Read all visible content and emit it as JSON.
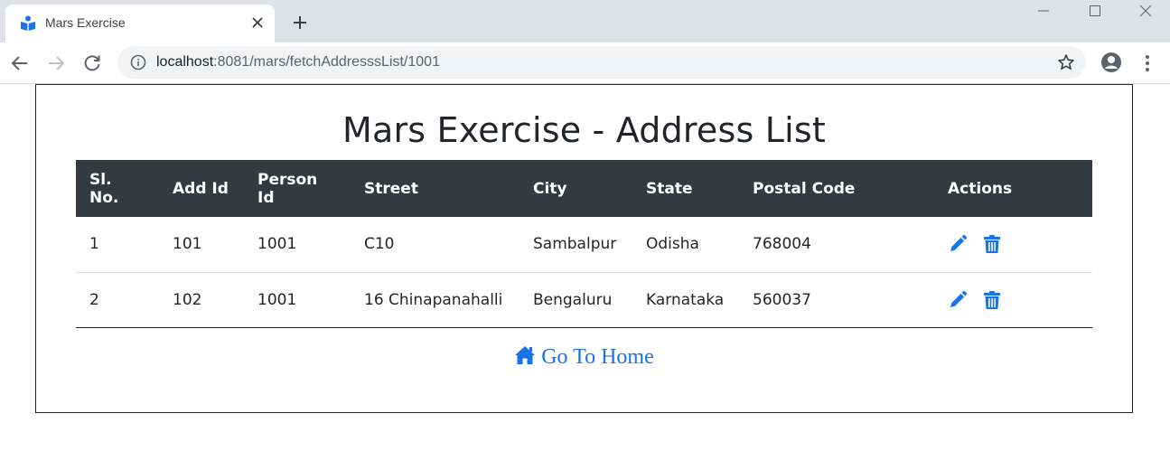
{
  "browser": {
    "tab_title": "Mars Exercise",
    "url_host": "localhost",
    "url_path": ":8081/mars/fetchAddresssList/1001"
  },
  "page": {
    "title": "Mars Exercise - Address List",
    "home_link": "Go To Home"
  },
  "table": {
    "headers": [
      "Sl. No.",
      "Add Id",
      "Person Id",
      "Street",
      "City",
      "State",
      "Postal Code",
      "Actions"
    ],
    "rows": [
      [
        "1",
        "101",
        "1001",
        "C10",
        "Sambalpur",
        "Odisha",
        "768004"
      ],
      [
        "2",
        "102",
        "1001",
        "16 Chinapanahalli",
        "Bengaluru",
        "Karnataka",
        "560037"
      ]
    ]
  },
  "colors": {
    "accent": "#1a73e8",
    "header_bg": "#343a40"
  },
  "icons": {
    "edit": "pencil-icon",
    "delete": "trash-icon",
    "home": "home-icon"
  }
}
